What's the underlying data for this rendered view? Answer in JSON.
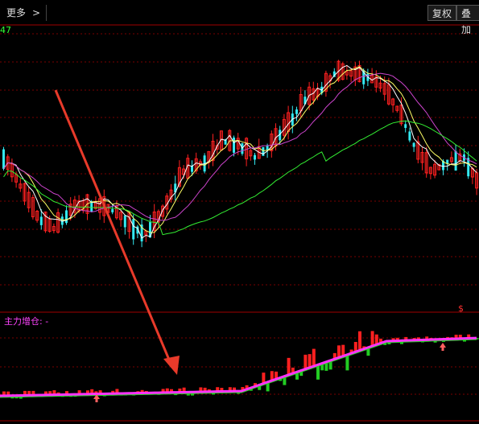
{
  "toolbar": {
    "more_label": "更多",
    "more_chevron": ">",
    "restore_label": "复权",
    "overlay_label": "叠加"
  },
  "price_panel": {
    "top_value": "47"
  },
  "indicator_panel": {
    "label": "主力增仓: -"
  },
  "colors": {
    "up": "#ff2020",
    "down": "#33e8f0",
    "ma_short": "#ffffff",
    "ma_mid": "#ffff66",
    "ma_long": "#cc44cc",
    "ma_xlong": "#33ee33",
    "grid": "#7a0000",
    "arrow": "#e83a2a",
    "ind_line_a": "#ff33ff",
    "ind_line_b": "#22cc22"
  },
  "icons": [
    "chevron-right-icon",
    "annotation-arrow-icon",
    "up-signal-icon",
    "dollar-marker-icon"
  ]
}
